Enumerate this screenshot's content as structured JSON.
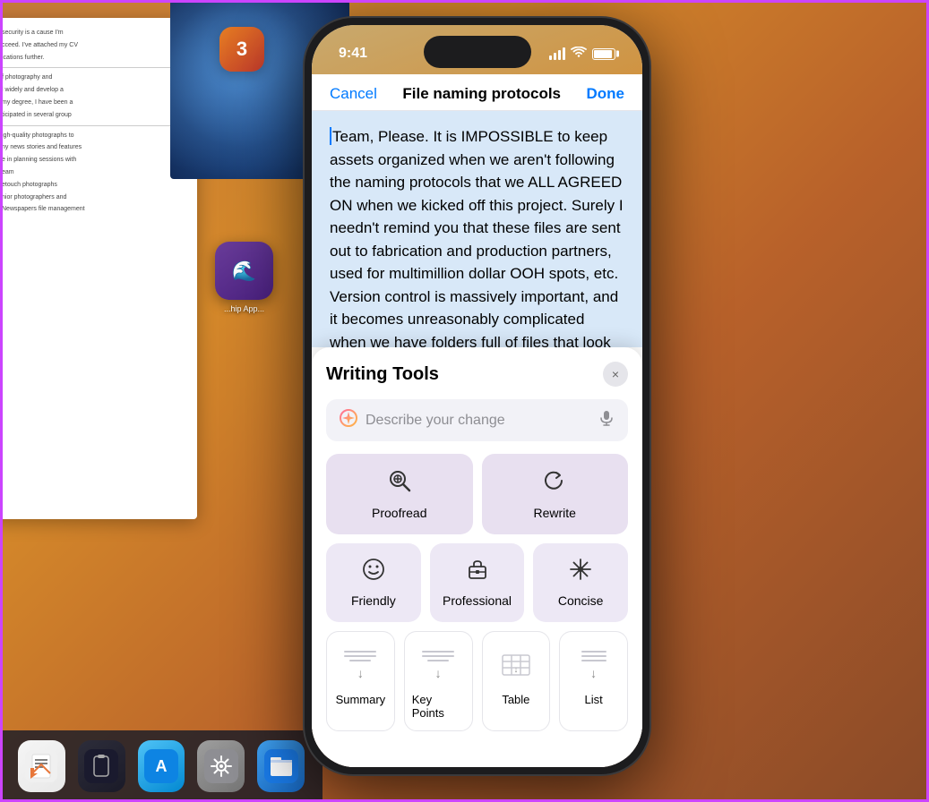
{
  "scene": {
    "border_color": "#cc44ff"
  },
  "cv_doc": {
    "text1": "security is a cause I'm",
    "text2": "cceed. I've attached my CV",
    "text3": "ications further.",
    "text4": "f photography and",
    "text5": "l widely and develop a",
    "text6": "my degree, I have been a",
    "text7": "ticipated in several group",
    "text8": "igh-quality photographs to",
    "text9": "ny news stories and features",
    "text10": "e in planning sessions with",
    "text11": "eam",
    "text12": "etouch photographs",
    "text13": "nior photographers and",
    "text14": "Newspapers file management"
  },
  "status_bar": {
    "time": "9:41",
    "signal": "●●●●",
    "wifi": "wifi",
    "battery": "battery"
  },
  "note": {
    "cancel_label": "Cancel",
    "title": "File naming protocols",
    "done_label": "Done",
    "content": "Team,\n\nPlease. It is IMPOSSIBLE to keep assets organized when we aren't following the naming protocols that we ALL AGREED ON when we kicked off this project. Surely I needn't remind you that these files are sent out to fabrication and production partners, used for multimillion dollar OOH spots, etc. Version control is massively important, and it becomes unreasonably complicated when we have folders full of files that look like this:"
  },
  "writing_tools": {
    "title": "Writing Tools",
    "close_icon": "×",
    "describe_placeholder": "Describe your change",
    "tools": [
      {
        "id": "proofread",
        "label": "Proofread",
        "icon": "🔍"
      },
      {
        "id": "rewrite",
        "label": "Rewrite",
        "icon": "↺"
      }
    ],
    "tone_tools": [
      {
        "id": "friendly",
        "label": "Friendly",
        "icon": "☺"
      },
      {
        "id": "professional",
        "label": "Professional",
        "icon": "💼"
      },
      {
        "id": "concise",
        "label": "Concise",
        "icon": "✳"
      }
    ],
    "format_tools": [
      {
        "id": "summary",
        "label": "Summary"
      },
      {
        "id": "key-points",
        "label": "Key Points"
      },
      {
        "id": "table",
        "label": "Table"
      },
      {
        "id": "list",
        "label": "List"
      }
    ]
  },
  "dock": {
    "apps": [
      {
        "id": "pages",
        "label": "Pages",
        "icon": "📄"
      },
      {
        "id": "topnotch",
        "label": "",
        "icon": "📱"
      },
      {
        "id": "appstore",
        "label": "",
        "icon": "A"
      },
      {
        "id": "settings",
        "label": "",
        "icon": "⚙"
      },
      {
        "id": "finder",
        "label": "",
        "icon": "📁"
      }
    ]
  },
  "notification": {
    "count": "3"
  },
  "desktop_app": {
    "label": "...hip App..."
  }
}
